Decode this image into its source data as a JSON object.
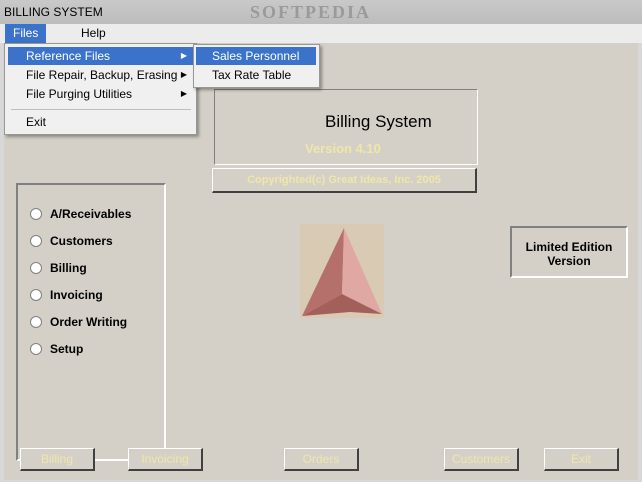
{
  "window": {
    "title": "BILLING SYSTEM",
    "watermark": "SOFTPEDIA"
  },
  "menubar": {
    "files": "Files",
    "help": "Help"
  },
  "files_menu": {
    "items": [
      {
        "label": "Reference Files",
        "has_submenu": true
      },
      {
        "label": "File Repair, Backup, Erasing",
        "has_submenu": true
      },
      {
        "label": "File Purging Utilities",
        "has_submenu": true
      },
      {
        "label": "Exit",
        "has_submenu": false
      }
    ]
  },
  "reference_submenu": {
    "items": [
      {
        "label": "Sales Personnel"
      },
      {
        "label": "Tax Rate Table"
      }
    ]
  },
  "header": {
    "app_name": "Billing System",
    "version": "Version 4.10"
  },
  "copyright_button": "Copyrighted(c) Great Ideas, Inc. 2005",
  "modules": [
    "A/Receivables",
    "Customers",
    "Billing",
    "Invoicing",
    "Order Writing",
    "Setup"
  ],
  "limited": {
    "line1": "Limited Edition",
    "line2": "Version"
  },
  "bottom_buttons": [
    "Billing",
    "Invoicing",
    "Orders",
    "Customers",
    "Exit"
  ],
  "colors": {
    "menu_highlight": "#3a73c9",
    "disabled_text": "#efe7a8",
    "logo_background": "#d9cbb3",
    "logo_triangle": "#c98a85"
  },
  "icons": {
    "logo": "triangle-logo-icon",
    "submenu": "submenu-arrow-icon",
    "radio": "radio-button-icon"
  }
}
